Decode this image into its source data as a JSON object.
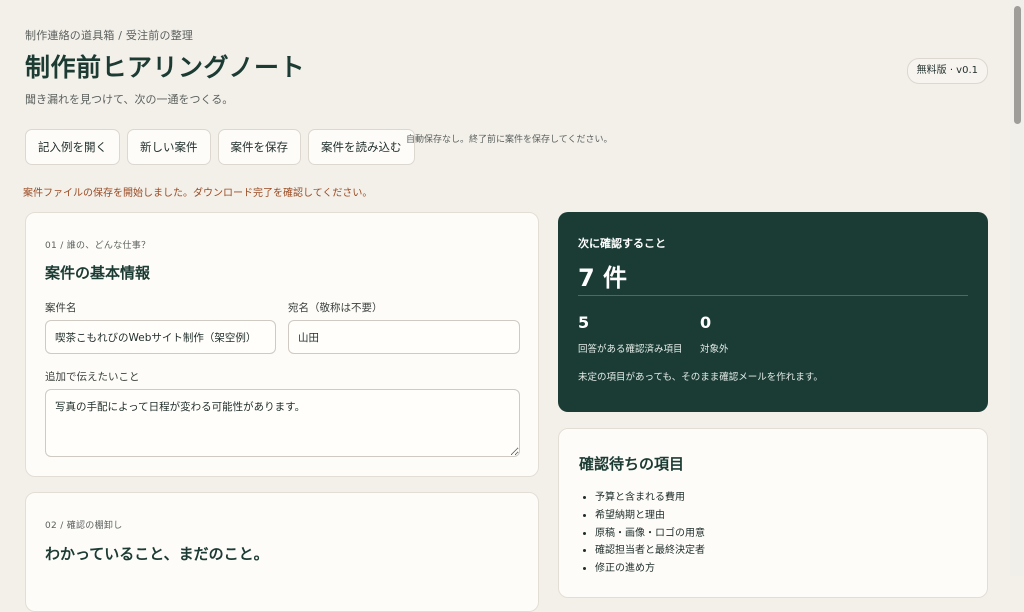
{
  "breadcrumb": "制作連絡の道具箱 / 受注前の整理",
  "header": {
    "title": "制作前ヒアリングノート",
    "subtitle": "聞き漏れを見つけて、次の一通をつくる。",
    "version_badge": "無料版 · v0.1"
  },
  "toolbar": {
    "open_example_label": "記入例を開く",
    "new_case_label": "新しい案件",
    "save_case_label": "案件を保存",
    "load_case_label": "案件を読み込む",
    "autosave_note": "自動保存なし。終了前に案件を保存してください。"
  },
  "status_message": "案件ファイルの保存を開始しました。ダウンロード完了を確認してください。",
  "basic_info": {
    "section_label": "01 / 誰の、どんな仕事？",
    "title": "案件の基本情報",
    "case_name_label": "案件名",
    "case_name_value": "喫茶こもれびのWebサイト制作（架空例）",
    "recipient_label": "宛名（敬称は不要）",
    "recipient_value": "山田",
    "notes_label": "追加で伝えたいこと",
    "notes_value": "写真の手配によって日程が変わる可能性があります。"
  },
  "confirmation": {
    "section_label": "02 / 確認の棚卸し",
    "title": "わかっていること、まだのこと。"
  },
  "summary": {
    "heading": "次に確認すること",
    "count": "7 件",
    "answered_value": "5",
    "answered_label": "回答がある確認済み項目",
    "excluded_value": "0",
    "excluded_label": "対象外",
    "note": "未定の項目があっても、そのまま確認メールを作れます。"
  },
  "pending": {
    "title": "確認待ちの項目",
    "items": [
      "予算と含まれる費用",
      "希望納期と理由",
      "原稿・画像・ロゴの用意",
      "確認担当者と最終決定者",
      "修正の進め方"
    ]
  }
}
